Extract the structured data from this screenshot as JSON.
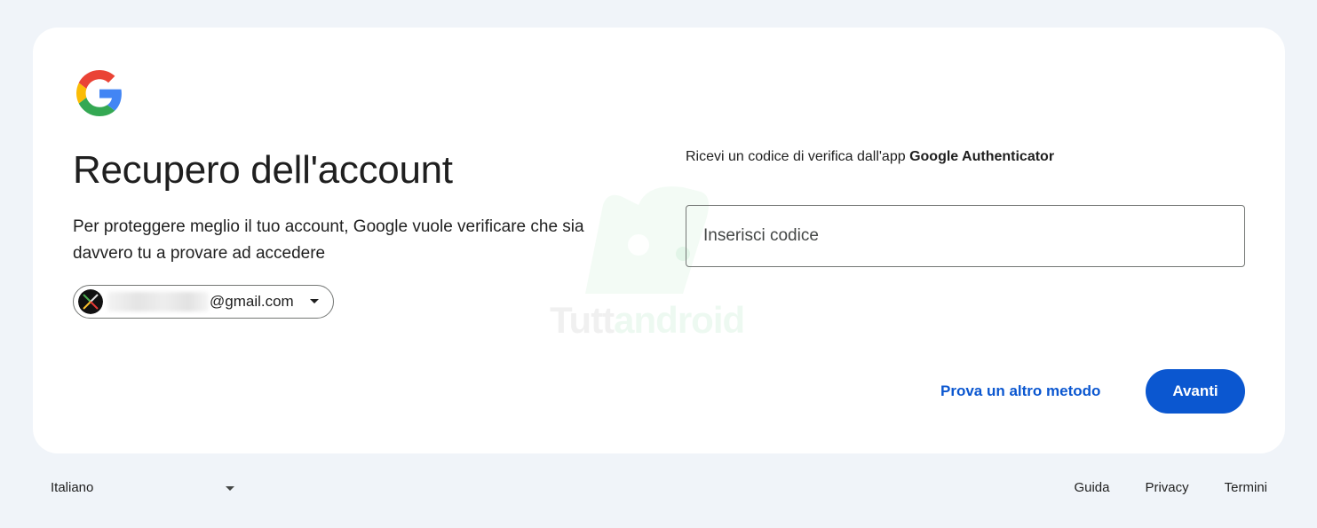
{
  "header": {
    "logo": "google-g-logo",
    "title": "Recupero dell'account",
    "subtitle": "Per proteggere meglio il tuo account, Google vuole verificare che sia davvero tu a provare ad accedere"
  },
  "account": {
    "email_suffix": "@gmail.com",
    "avatar_icon": "avatar-x-icon",
    "caret_icon": "caret-down-icon"
  },
  "verification": {
    "instruction_prefix": "Ricevi un codice di verifica dall'app ",
    "instruction_app": "Google Authenticator",
    "code_placeholder": "Inserisci codice",
    "code_value": ""
  },
  "actions": {
    "alt_method_label": "Prova un altro metodo",
    "next_label": "Avanti"
  },
  "watermark": {
    "text_part1": "Tutt",
    "text_part2": "android"
  },
  "footer": {
    "language": "Italiano",
    "links": [
      "Guida",
      "Privacy",
      "Termini"
    ]
  },
  "colors": {
    "background": "#f0f4f9",
    "card": "#ffffff",
    "primary": "#0b57d0",
    "text": "#1f1f1f",
    "border": "#747775"
  }
}
